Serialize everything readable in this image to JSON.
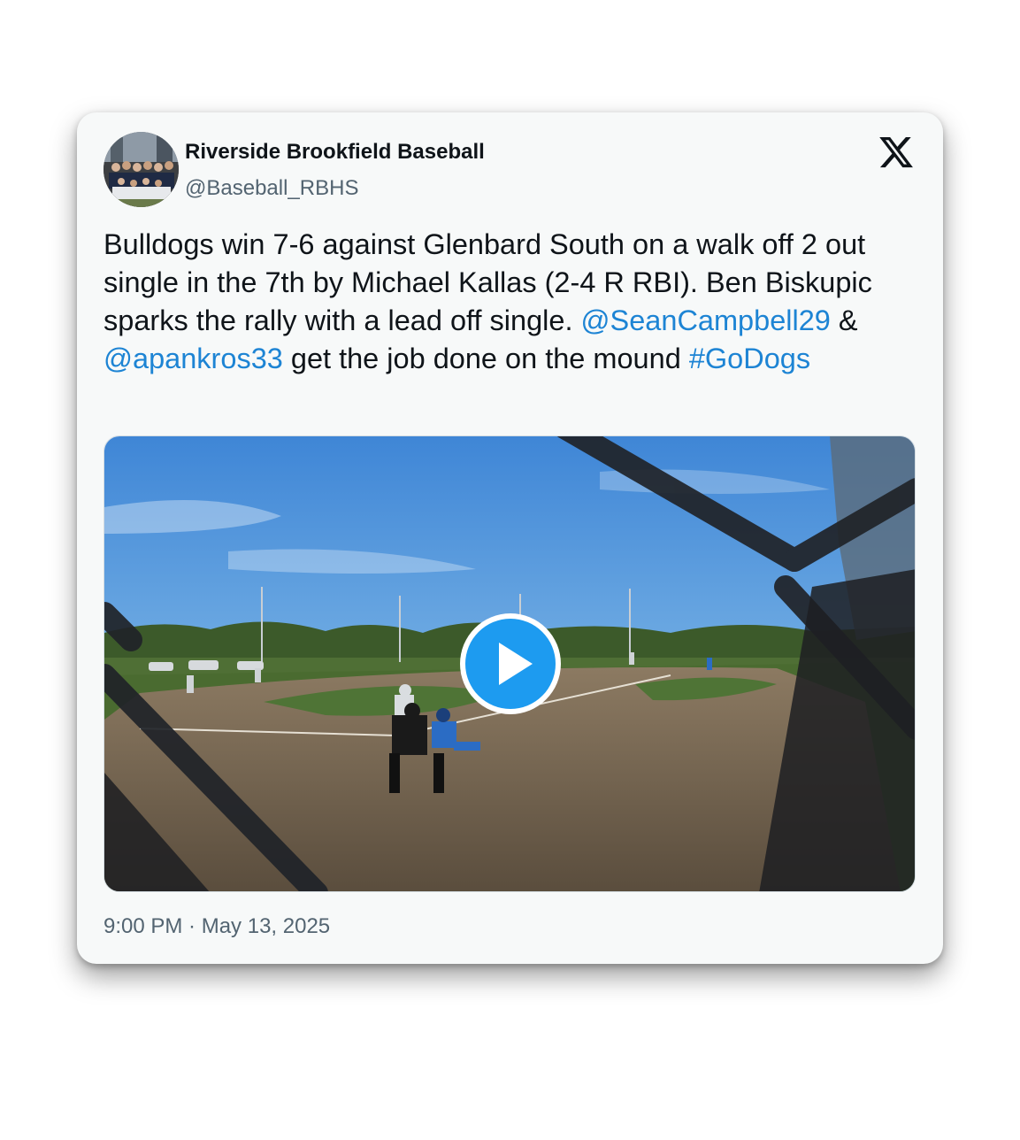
{
  "account": {
    "display_name": "Riverside Brookfield Baseball",
    "handle": "@Baseball_RBHS",
    "avatar_icon": "team-photo-avatar"
  },
  "platform": {
    "logo_icon": "x-logo-icon"
  },
  "tweet": {
    "text_part1": "Bulldogs win 7-6 against Glenbard South on a walk off 2 out single in the 7th by Michael Kallas (2-4 R RBI). Ben Biskupic sparks the rally with a lead off single. ",
    "mention1": "@SeanCampbell29",
    "text_part2": " & ",
    "mention2": "@apankros33",
    "text_part3": " get the job done on the mound ",
    "hashtag": "#GoDogs",
    "link_color": "#1d84d4"
  },
  "media": {
    "type": "video",
    "play_icon": "play-icon",
    "accent_color": "#1d9bf0"
  },
  "timestamp": "9:00 PM · May 13, 2025"
}
